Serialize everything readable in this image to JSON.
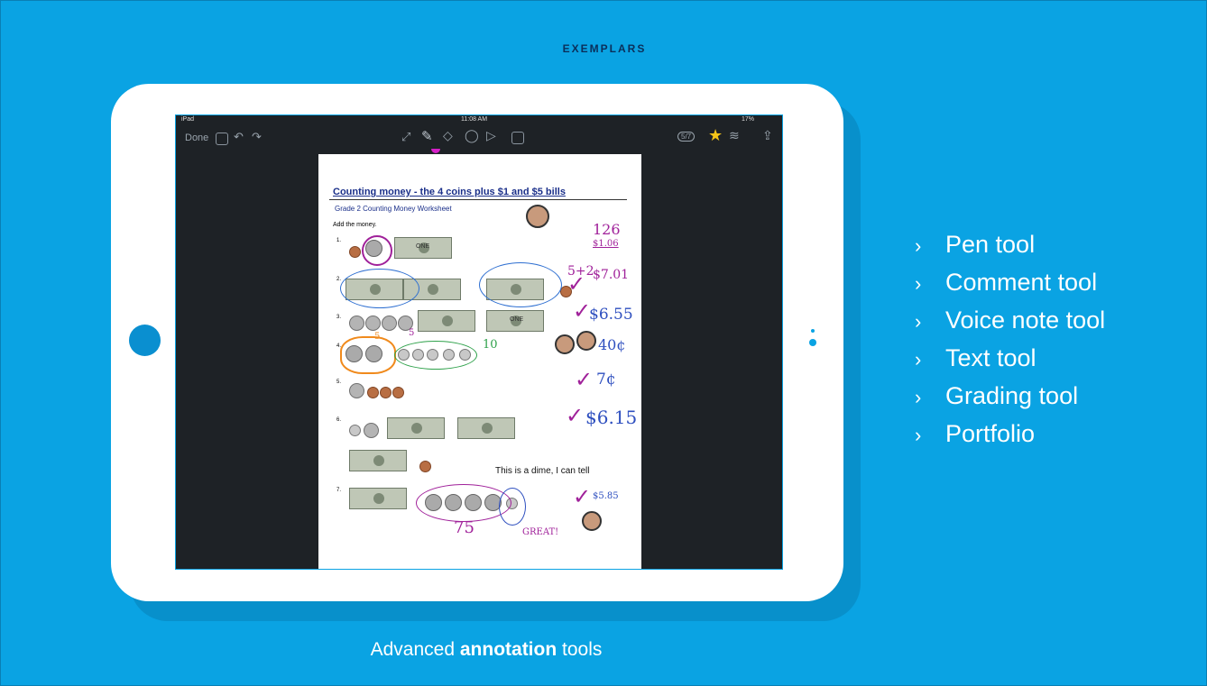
{
  "header": {
    "kicker": "EXEMPLARS"
  },
  "device": {
    "status_left": "iPad",
    "status_time": "11:08 AM",
    "status_right": "17%",
    "toolbar": {
      "done_label": "Done",
      "page_counter": "5/7"
    }
  },
  "worksheet": {
    "title": "Counting money - the 4 coins plus $1 and $5 bills",
    "subtitle": "Grade 2 Counting Money Worksheet",
    "instruction": "Add the money.",
    "row_numbers": [
      "1.",
      "2.",
      "3.",
      "4.",
      "5.",
      "6.",
      "7."
    ],
    "bill_text": "ONE",
    "handwriting": {
      "a1_top": "126",
      "a1": "$1.06",
      "a2_note": "5+2",
      "a2": "$7.01",
      "a3": "$6.55",
      "a4": "40¢",
      "a4_tally": "10",
      "a4_five": "5",
      "a5": "7¢",
      "a6": "$6.15",
      "a7": "$5.85",
      "a7_total": "75",
      "comment": "This is a dime, I can tell",
      "great": "GREAT!"
    }
  },
  "features": [
    "Pen tool",
    "Comment tool",
    "Voice note tool",
    "Text tool",
    "Grading tool",
    "Portfolio"
  ],
  "caption": {
    "prefix": "Advanced ",
    "bold": "annotation",
    "suffix": " tools"
  },
  "colors": {
    "background": "#0aa3e3",
    "accent_ink": "#a0219a",
    "blue_ink": "#2e4fbf"
  }
}
